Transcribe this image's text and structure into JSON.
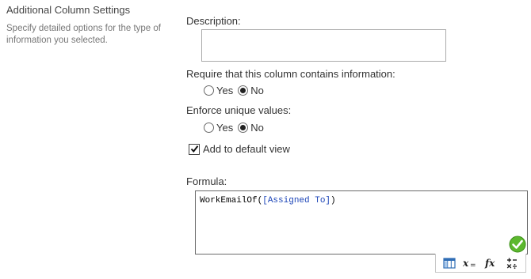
{
  "section": {
    "title": "Additional Column Settings",
    "description": "Specify detailed options for the type of information you selected."
  },
  "description_field": {
    "label": "Description:",
    "value": ""
  },
  "require": {
    "label": "Require that this column contains information:",
    "options": [
      "Yes",
      "No"
    ],
    "selected": "No"
  },
  "unique": {
    "label": "Enforce unique values:",
    "options": [
      "Yes",
      "No"
    ],
    "selected": "No"
  },
  "default_view": {
    "label": "Add to default view",
    "checked": true
  },
  "formula": {
    "label": "Formula:",
    "func": "WorkEmailOf(",
    "ref": "[Assigned To]",
    "close": ")"
  },
  "toolbar": {
    "icons": [
      "column-picker-icon",
      "variable-icon",
      "function-icon",
      "operators-icon"
    ]
  },
  "colors": {
    "ok_green": "#5cb82e",
    "ref_blue": "#1c45b8"
  }
}
